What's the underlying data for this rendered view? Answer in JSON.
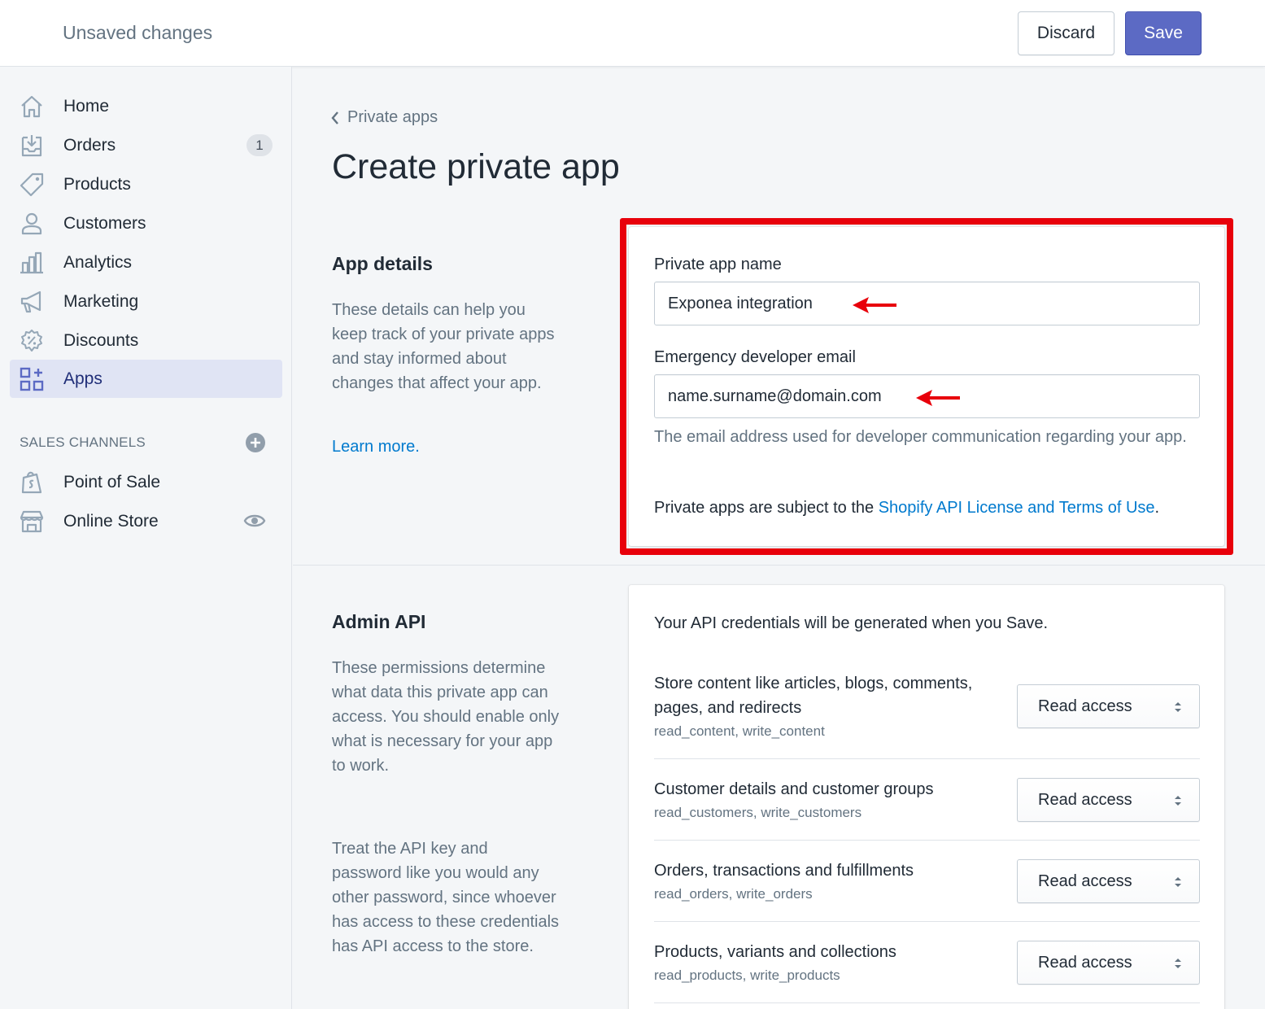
{
  "topbar": {
    "title": "Unsaved changes",
    "discard_label": "Discard",
    "save_label": "Save"
  },
  "sidebar": {
    "items": [
      {
        "label": "Home",
        "icon": "home-icon"
      },
      {
        "label": "Orders",
        "icon": "orders-icon",
        "badge": "1"
      },
      {
        "label": "Products",
        "icon": "tag-icon"
      },
      {
        "label": "Customers",
        "icon": "person-icon"
      },
      {
        "label": "Analytics",
        "icon": "bar-chart-icon"
      },
      {
        "label": "Marketing",
        "icon": "megaphone-icon"
      },
      {
        "label": "Discounts",
        "icon": "discount-icon"
      },
      {
        "label": "Apps",
        "icon": "apps-icon",
        "active": true
      }
    ],
    "sales_channels_heading": "SALES CHANNELS",
    "channels": [
      {
        "label": "Point of Sale",
        "icon": "shopify-bag-icon"
      },
      {
        "label": "Online Store",
        "icon": "store-icon"
      }
    ]
  },
  "breadcrumb": {
    "label": "Private apps"
  },
  "page_title": "Create private app",
  "app_details": {
    "title": "App details",
    "description": "These details can help you keep track of your private apps and stay informed about changes that affect your app.",
    "learn_more": "Learn more.",
    "name_label": "Private app name",
    "name_value": "Exponea integration",
    "email_label": "Emergency developer email",
    "email_value": "name.surname@domain.com",
    "email_help": "The email address used for developer communication regarding your app.",
    "terms_prefix": "Private apps are subject to the ",
    "terms_link": "Shopify API License and Terms of Use",
    "terms_suffix": "."
  },
  "admin_api": {
    "title": "Admin API",
    "description_1": "These permissions determine what data this private app can access. You should enable only what is necessary for your app to work.",
    "description_2": "Treat the API key and password like you would any other password, since whoever has access to these credentials has API access to the store.",
    "credentials_note": "Your API credentials will be generated when you Save.",
    "permissions": [
      {
        "name": "Store content like articles, blogs, comments, pages, and redirects",
        "scope": "read_content, write_content",
        "access": "Read access"
      },
      {
        "name": "Customer details and customer groups",
        "scope": "read_customers, write_customers",
        "access": "Read access"
      },
      {
        "name": "Orders, transactions and fulfillments",
        "scope": "read_orders, write_orders",
        "access": "Read access"
      },
      {
        "name": "Products, variants and collections",
        "scope": "read_products, write_products",
        "access": "Read access"
      }
    ]
  },
  "colors": {
    "accent": "#5c6ac4",
    "annotation_red": "#e8000b",
    "link": "#007ace"
  }
}
